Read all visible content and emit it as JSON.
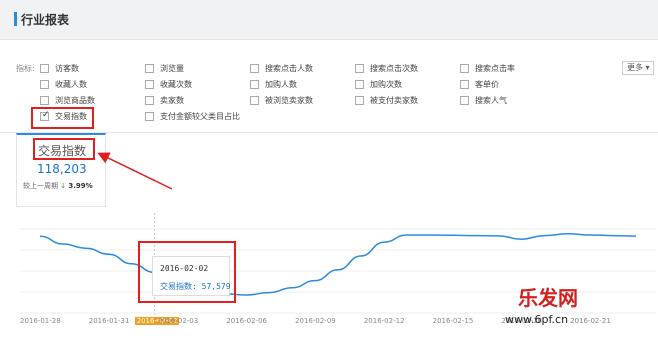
{
  "header": {
    "title": "行业报表"
  },
  "metrics": {
    "label": "指标:",
    "more_label": "更多 ▾",
    "options": [
      {
        "label": "访客数",
        "checked": false
      },
      {
        "label": "浏览量",
        "checked": false
      },
      {
        "label": "搜索点击人数",
        "checked": false
      },
      {
        "label": "搜索点击次数",
        "checked": false
      },
      {
        "label": "搜索点击率",
        "checked": false
      },
      {
        "label": "收藏人数",
        "checked": false
      },
      {
        "label": "收藏次数",
        "checked": false
      },
      {
        "label": "加购人数",
        "checked": false
      },
      {
        "label": "加购次数",
        "checked": false
      },
      {
        "label": "客单价",
        "checked": false
      },
      {
        "label": "浏览商品数",
        "checked": false
      },
      {
        "label": "卖家数",
        "checked": false
      },
      {
        "label": "被浏览卖家数",
        "checked": false
      },
      {
        "label": "被支付卖家数",
        "checked": false
      },
      {
        "label": "搜索人气",
        "checked": false
      },
      {
        "label": "交易指数",
        "checked": true
      },
      {
        "label": "支付金额较父类目占比",
        "checked": false
      }
    ]
  },
  "card": {
    "title": "交易指数",
    "value": "118,203",
    "compare_label": "较上一周期",
    "trend_icon": "↓",
    "compare_pct": "3.99%"
  },
  "tooltip": {
    "date": "2016-02-02",
    "label": "交易指数: 57,579"
  },
  "chart_data": {
    "type": "line",
    "x": [
      "2016-01-28",
      "2016-01-29",
      "2016-01-30",
      "2016-01-31",
      "2016-02-01",
      "2016-02-02",
      "2016-02-03",
      "2016-02-04",
      "2016-02-05",
      "2016-02-06",
      "2016-02-07",
      "2016-02-08",
      "2016-02-09",
      "2016-02-10",
      "2016-02-11",
      "2016-02-12",
      "2016-02-13",
      "2016-02-14",
      "2016-02-15",
      "2016-02-16",
      "2016-02-17",
      "2016-02-18",
      "2016-02-19",
      "2016-02-20",
      "2016-02-21",
      "2016-02-22",
      "2016-02-23"
    ],
    "series": [
      {
        "values": [
          118000,
          105000,
          98000,
          88000,
          72000,
          57579,
          42000,
          30000,
          22000,
          20000,
          24000,
          32000,
          44000,
          62000,
          85000,
          108000,
          120000,
          120000,
          119500,
          119000,
          118500,
          113000,
          119000,
          122000,
          120000,
          119000,
          118203
        ]
      }
    ],
    "xticks": [
      "2016-01-28",
      "2016-01-31",
      "2016-02-02",
      "2016-02-03",
      "2016-02-06",
      "2016-02-09",
      "2016-02-12",
      "2016-02-15",
      "2016-02-18",
      "2016-02-21"
    ],
    "highlight_x": "2016-02-02",
    "line_color": "#2a8be0",
    "ylim": [
      0,
      140000
    ],
    "grid": true
  },
  "watermark": {
    "logo_text": "乐发网",
    "url": "www.6pf.cn"
  },
  "colors": {
    "accent": "#2a8be0",
    "highlight": "#e02020",
    "tick_highlight": "#f0a020"
  }
}
